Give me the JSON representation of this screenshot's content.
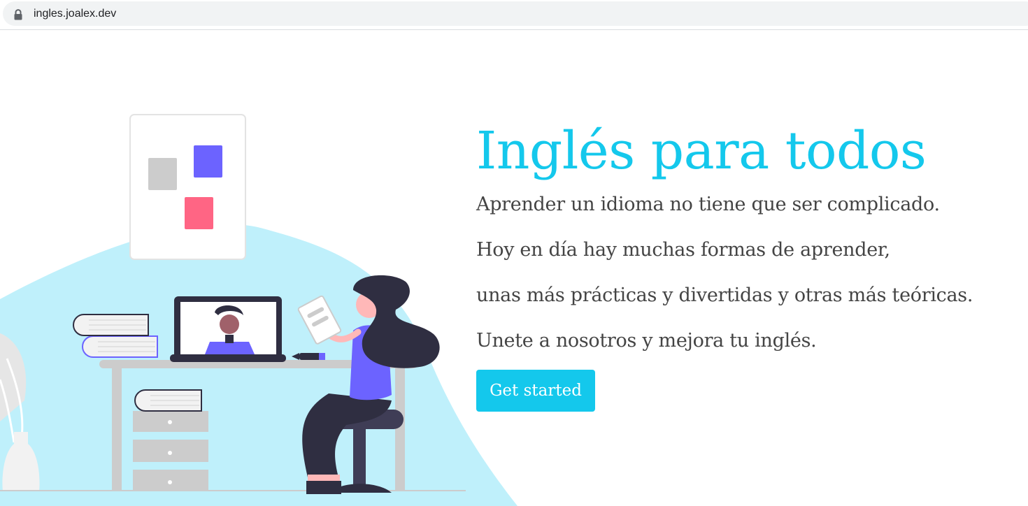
{
  "browser": {
    "url": "ingles.joalex.dev",
    "lock_icon": "lock-icon"
  },
  "hero": {
    "title": "Inglés para todos",
    "lines": [
      "Aprender un idioma no tiene que ser complicado.",
      "Hoy en día hay muchas formas de aprender,",
      "unas más prácticas y divertidas y otras más teóricas.",
      "Unete a nosotros y mejora tu inglés."
    ],
    "cta_label": "Get started"
  },
  "colors": {
    "accent": "#14c8ec",
    "text": "#444444",
    "illustration_bg": "#bff0fb",
    "purple": "#6c63ff",
    "pink": "#ff6584",
    "dark": "#2f2e41"
  }
}
